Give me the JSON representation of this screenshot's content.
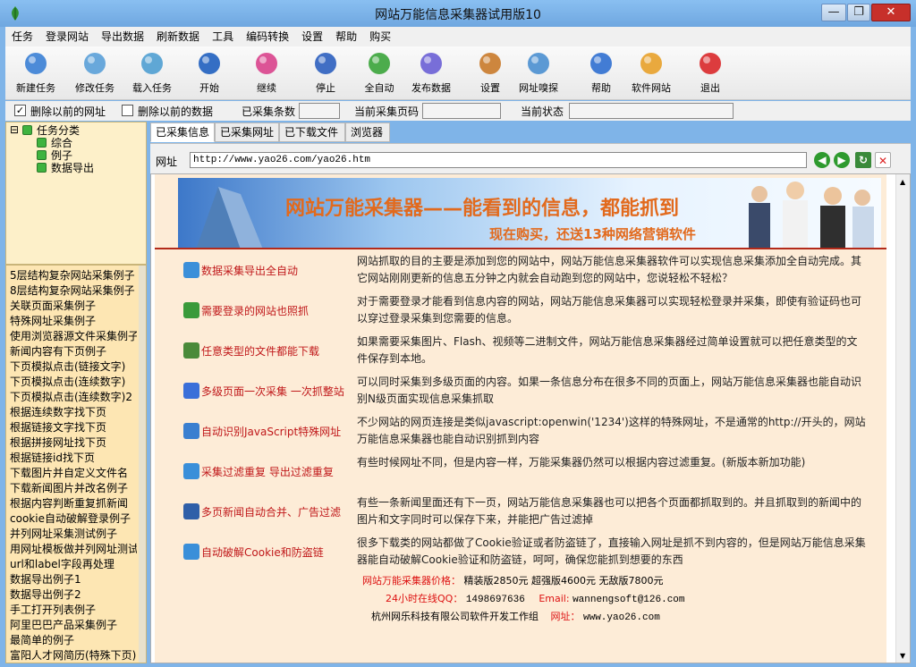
{
  "window": {
    "title": "网站万能信息采集器试用版10",
    "min": "—",
    "max": "❐",
    "close": "✕"
  },
  "menu": [
    "任务",
    "登录网站",
    "导出数据",
    "刷新数据",
    "工具",
    "编码转换",
    "设置",
    "帮助",
    "购买"
  ],
  "toolbar": [
    {
      "label": "新建任务",
      "icon": "new-task-icon",
      "color": "#3a7fd5"
    },
    {
      "label": "修改任务",
      "icon": "edit-task-icon",
      "color": "#5aa0d8"
    },
    {
      "label": "载入任务",
      "icon": "load-task-icon",
      "color": "#4f9fd1"
    },
    {
      "label": "开始",
      "icon": "play-icon",
      "color": "#1f5fbf"
    },
    {
      "label": "继续",
      "icon": "continue-icon",
      "color": "#d9428c"
    },
    {
      "label": "停止",
      "icon": "stop-icon",
      "color": "#2c5fbf"
    },
    {
      "label": "全自动",
      "icon": "refresh-icon",
      "color": "#3aa43a"
    },
    {
      "label": "发布数据",
      "icon": "publish-icon",
      "color": "#6a5fd5"
    },
    {
      "label": "设置",
      "icon": "tools-icon",
      "color": "#c97a2a"
    },
    {
      "label": "网址嗅探",
      "icon": "sniff-icon",
      "color": "#4a8fd0"
    },
    {
      "label": "帮助",
      "icon": "help-icon",
      "color": "#2f6fd0"
    },
    {
      "label": "软件网站",
      "icon": "home-icon",
      "color": "#e8a12a"
    },
    {
      "label": "退出",
      "icon": "exit-icon",
      "color": "#d9282a"
    }
  ],
  "options": {
    "delete_urls_label": "删除以前的网址",
    "delete_urls_checked": "✓",
    "delete_data_label": "删除以前的数据",
    "collected_label": "已采集条数",
    "current_page_label": "当前采集页码",
    "state_label": "当前状态"
  },
  "tree": {
    "root": "任务分类",
    "toggle": "⊟",
    "children": [
      "综合",
      "例子",
      "数据导出"
    ]
  },
  "list": [
    "5层结构复杂网站采集例子",
    "8层结构复杂网站采集例子",
    "关联页面采集例子",
    "特殊网址采集例子",
    "使用浏览器源文件采集例子",
    "新闻内容有下页例子",
    "下页模拟点击(链接文字)",
    "下页模拟点击(连续数字)",
    "下页模拟点击(连续数字)2",
    "根据连续数字找下页",
    "根据链接文字找下页",
    "根据拼接网址找下页",
    "根据链接id找下页",
    "下载图片并自定义文件名",
    "下载新闻图片并改名例子",
    "根据内容判断重复抓新闻",
    "cookie自动破解登录例子",
    "并列网址采集测试例子",
    "用网址模板做并列网址测试",
    "url和label字段再处理",
    "数据导出例子1",
    "数据导出例子2",
    "手工打开列表例子",
    "阿里巴巴产品采集例子",
    "最简单的例子",
    "富阳人才网简历(特殊下页)"
  ],
  "tabs": [
    "已采集信息",
    "已采集网址",
    "已下载文件",
    "浏览器"
  ],
  "urlbar": {
    "label": "网址",
    "value": "http://www.yao26.com/yao26.htm",
    "back": "◀",
    "forward": "▶",
    "refresh": "↻",
    "stop": "✕"
  },
  "banner": {
    "title": "网站万能采集器——能看到的信息，都能抓到",
    "subtitle": "现在购买，还送13种网络营销软件"
  },
  "features": [
    {
      "title": "数据采集导出全自动",
      "desc": "网站抓取的目的主要是添加到您的网站中，网站万能信息采集器软件可以实现信息采集添加全自动完成。其它网站刚刚更新的信息五分钟之内就会自动跑到您的网站中，您说轻松不轻松？",
      "icon": "globe-icon",
      "color": "#3b8fd9"
    },
    {
      "title": "需要登录的网站也照抓",
      "desc": "对于需要登录才能看到信息内容的网站，网站万能信息采集器可以实现轻松登录并采集，即使有验证码也可以穿过登录采集到您需要的信息。",
      "icon": "floppy-icon",
      "color": "#3a9a3a"
    },
    {
      "title": "任意类型的文件都能下载",
      "desc": "如果需要采集图片、Flash、视频等二进制文件，网站万能信息采集器经过简单设置就可以把任意类型的文件保存到本地。",
      "icon": "document-icon",
      "color": "#4a8a3a"
    },
    {
      "title": "多级页面一次采集 一次抓整站",
      "desc": "可以同时采集到多级页面的内容。如果一条信息分布在很多不同的页面上，网站万能信息采集器也能自动识别N级页面实现信息采集抓取",
      "icon": "piechart-icon",
      "color": "#3a6fd9"
    },
    {
      "title": "自动识别JavaScript特殊网址",
      "desc": "不少网站的网页连接是类似javascript:openwin('1234')这样的特殊网址，不是通常的http://开头的，网站万能信息采集器也能自动识别抓到内容",
      "icon": "calendar-icon",
      "color": "#3a7fd0"
    },
    {
      "title": "采集过滤重复 导出过滤重复",
      "desc": "有些时候网址不同，但是内容一样，万能采集器仍然可以根据内容过滤重复。(新版本新加功能)",
      "icon": "filter-icon",
      "color": "#3a8fd9"
    },
    {
      "title": "多页新闻自动合并、广告过滤",
      "desc": "有些一条新闻里面还有下一页，网站万能信息采集器也可以把各个页面都抓取到的。并且抓取到的新闻中的图片和文字同时可以保存下来，并能把广告过滤掉",
      "icon": "monitor-icon",
      "color": "#2f5fa8"
    },
    {
      "title": "自动破解Cookie和防盗链",
      "desc": "很多下载类的网站都做了Cookie验证或者防盗链了，直接输入网址是抓不到内容的，但是网站万能信息采集器能自动破解Cookie验证和防盗链，呵呵，确保您能抓到想要的东西",
      "icon": "magnifier-icon",
      "color": "#3a8fd9"
    }
  ],
  "footer": {
    "price_label": "网站万能采集器价格：",
    "price_value": "精装版2850元 超强版4600元 无敌版7800元",
    "qq_label": "24小时在线QQ：",
    "qq_value": "1498697636",
    "email_label": "Email:",
    "email_value": "wannengsoft@126.com",
    "company": "杭州网乐科技有限公司软件开发工作组",
    "site_label": "网址：",
    "site_value": "www.yao26.com"
  }
}
